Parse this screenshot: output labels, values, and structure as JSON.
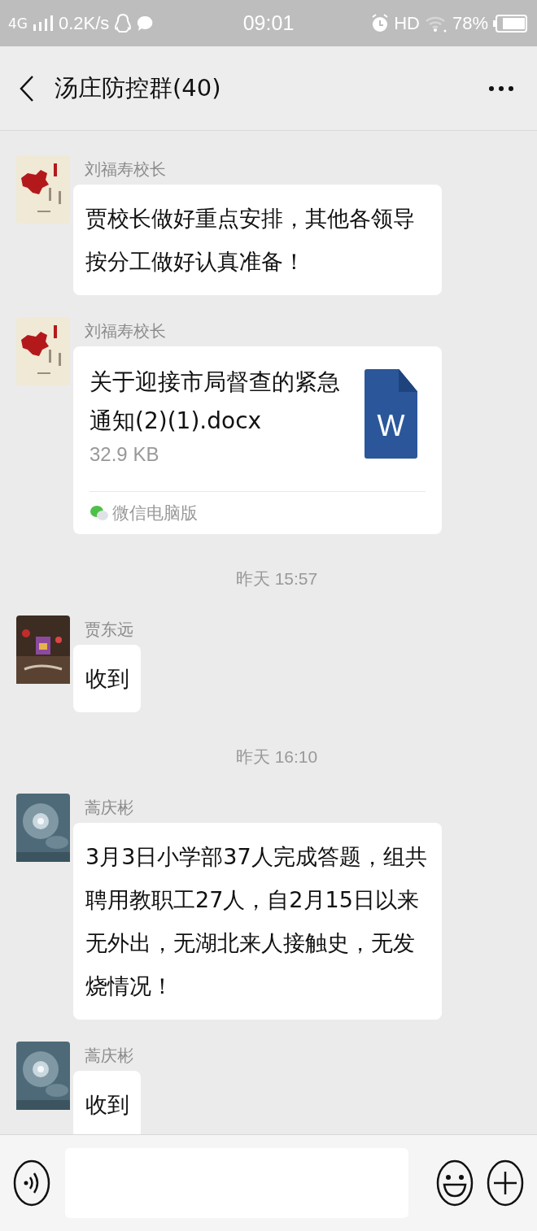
{
  "status_bar": {
    "network": "4G",
    "speed": "0.2K/s",
    "time": "09:01",
    "hd": "HD",
    "battery": "78%"
  },
  "header": {
    "title": "汤庄防控群(40)"
  },
  "messages": [
    {
      "kind": "text",
      "sender": "刘福寿校长",
      "text": "贾校长做好重点安排，其他各领导按分工做好认真准备！"
    },
    {
      "kind": "file",
      "sender": "刘福寿校长",
      "file_name": "关于迎接市局督查的紧急通知(2)(1).docx",
      "size": "32.9 KB",
      "icon_letter": "W",
      "source": "微信电脑版"
    },
    {
      "kind": "time",
      "text": "昨天 15:57"
    },
    {
      "kind": "text",
      "sender": "贾东远",
      "text": "收到"
    },
    {
      "kind": "time",
      "text": "昨天 16:10"
    },
    {
      "kind": "text",
      "sender": "蒿庆彬",
      "text": "3月3日小学部37人完成答题，组共聘用教职工27人，自2月15日以来无外出，无湖北来人接触史，无发烧情况！"
    },
    {
      "kind": "text",
      "sender": "蒿庆彬",
      "text": "收到"
    }
  ]
}
